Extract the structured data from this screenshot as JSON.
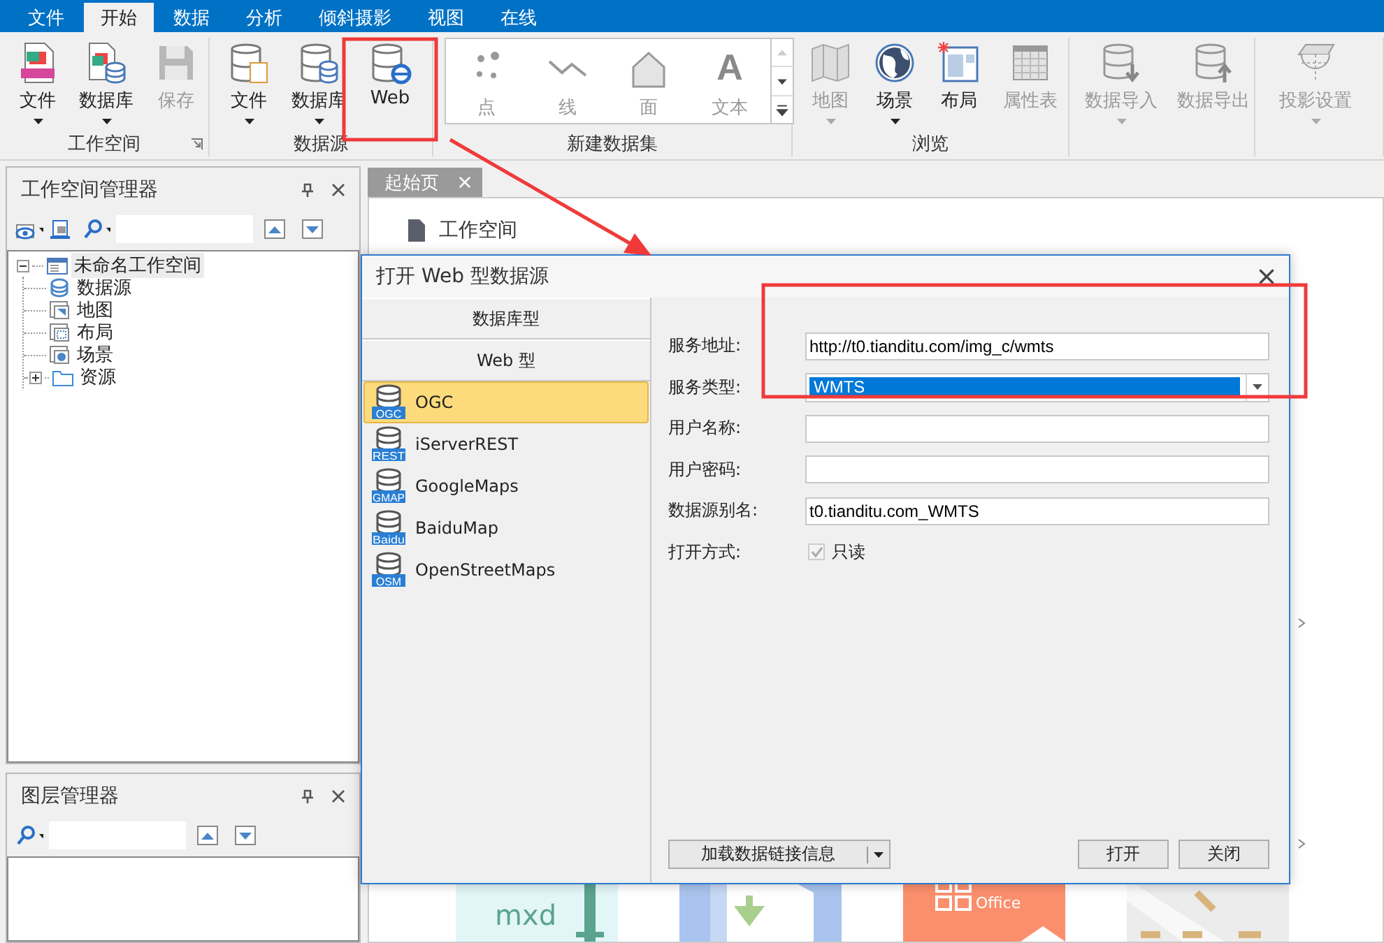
{
  "menu_tabs": [
    {
      "label": "文件",
      "selected": false
    },
    {
      "label": "开始",
      "selected": true
    },
    {
      "label": "数据",
      "selected": false
    },
    {
      "label": "分析",
      "selected": false
    },
    {
      "label": "倾斜摄影",
      "selected": false
    },
    {
      "label": "视图",
      "selected": false
    },
    {
      "label": "在线",
      "selected": false
    }
  ],
  "ribbon": {
    "groups": [
      {
        "kind": "buttons",
        "label": "工作空间",
        "launcher": true,
        "buttons": [
          {
            "label": "文件",
            "dropdown": true,
            "disabled": false
          },
          {
            "label": "数据库",
            "dropdown": true,
            "disabled": false
          },
          {
            "label": "保存",
            "dropdown": false,
            "disabled": true
          }
        ]
      },
      {
        "kind": "buttons",
        "label": "数据源",
        "buttons": [
          {
            "label": "文件",
            "dropdown": true,
            "disabled": false
          },
          {
            "label": "数据库",
            "dropdown": true,
            "disabled": false
          },
          {
            "label": "Web",
            "dropdown": false,
            "disabled": false
          }
        ]
      },
      {
        "kind": "gallery",
        "label": "新建数据集",
        "buttons": [
          {
            "label": "点",
            "disabled": true
          },
          {
            "label": "线",
            "disabled": true
          },
          {
            "label": "面",
            "disabled": true
          },
          {
            "label": "文本",
            "glyph": "A",
            "disabled": true
          }
        ]
      },
      {
        "kind": "buttons",
        "label": "浏览",
        "buttons": [
          {
            "label": "地图",
            "dropdown": true,
            "disabled": true
          },
          {
            "label": "场景",
            "dropdown": true,
            "disabled": false
          },
          {
            "label": "布局",
            "dropdown": false,
            "disabled": false
          },
          {
            "label": "属性表",
            "dropdown": false,
            "disabled": true
          }
        ]
      },
      {
        "kind": "buttons",
        "buttons": [
          {
            "label": "数据导入",
            "dropdown": true,
            "disabled": true
          },
          {
            "label": "数据导出",
            "dropdown": false,
            "disabled": true
          }
        ]
      },
      {
        "kind": "buttons",
        "buttons": [
          {
            "label": "投影设置",
            "dropdown": true,
            "disabled": true
          }
        ]
      }
    ]
  },
  "workspace_manager": {
    "title": "工作空间管理器",
    "tree": [
      {
        "label": "未命名工作空间",
        "selected": true,
        "expanded": true,
        "children": [
          {
            "label": "数据源",
            "selected": false
          },
          {
            "label": "地图",
            "selected": false
          },
          {
            "label": "布局",
            "selected": false
          },
          {
            "label": "场景",
            "selected": false
          },
          {
            "label": "资源",
            "selected": false,
            "expanded": false
          }
        ]
      }
    ]
  },
  "layer_manager": {
    "title": "图层管理器"
  },
  "start_page": {
    "tab": "起始页",
    "heading": "工作空间",
    "thumbnails": [
      {
        "kind": "mxd",
        "label": "mxd"
      },
      {
        "kind": "import"
      },
      {
        "kind": "office",
        "label": "Office"
      },
      {
        "kind": "map"
      }
    ]
  },
  "dialog": {
    "title": "打开 Web 型数据源",
    "categories": [
      "数据库型",
      "Web 型"
    ],
    "sources": [
      {
        "label": "OGC",
        "badge": "OGC",
        "selected": true
      },
      {
        "label": "iServerREST",
        "badge": "REST",
        "selected": false
      },
      {
        "label": "GoogleMaps",
        "badge": "GMAP",
        "selected": false
      },
      {
        "label": "BaiduMap",
        "badge": "Baidu",
        "selected": false
      },
      {
        "label": "OpenStreetMaps",
        "badge": "OSM",
        "selected": false
      }
    ],
    "fields": [
      {
        "kind": "text",
        "label": "服务地址:",
        "value": "http://t0.tianditu.com/img_c/wmts"
      },
      {
        "kind": "combo",
        "label": "服务类型:",
        "value": "WMTS",
        "highlighted": true
      },
      {
        "kind": "text",
        "label": "用户名称:"
      },
      {
        "kind": "password",
        "label": "用户密码:"
      },
      {
        "kind": "text",
        "label": "数据源别名:",
        "value": "t0.tianditu.com_WMTS"
      },
      {
        "kind": "checkbox",
        "label": "打开方式:",
        "option": "只读",
        "checked": true,
        "disabled": true
      }
    ],
    "load_button": "加载数据链接信息",
    "buttons": [
      "打开",
      "关闭"
    ]
  }
}
